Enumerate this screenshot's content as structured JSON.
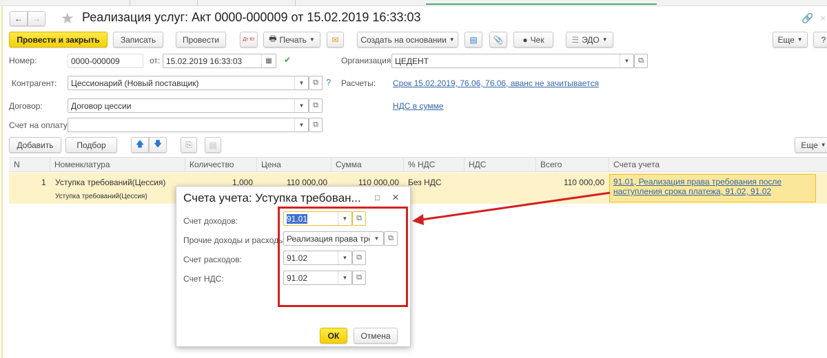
{
  "window": {
    "title": "Реализация услуг: Акт 0000-000009 от 15.02.2019 16:33:03"
  },
  "toolbar": {
    "post_close": "Провести и закрыть",
    "save": "Записать",
    "post": "Провести",
    "dtkt": "Дт Кт",
    "print": "Печать",
    "create_based": "Создать на основании",
    "check": "Чек",
    "edo": "ЭДО",
    "more": "Еще",
    "help": "?"
  },
  "form": {
    "number_label": "Номер:",
    "number": "0000-000009",
    "date_label": "от:",
    "date": "15.02.2019 16:33:03",
    "org_label": "Организация:",
    "org": "ЦЕДЕНТ",
    "counterparty_label": "Контрагент:",
    "counterparty": "Цессионарий (Новый поставщик)",
    "settlements_label": "Расчеты:",
    "settlements_link": "Срок 15.02.2019, 76.06, 76.06, аванс не зачитывается",
    "contract_label": "Договор:",
    "contract": "Договор цессии",
    "vat_link": "НДС в сумме",
    "invoice_label": "Счет на оплату:",
    "invoice": ""
  },
  "table_toolbar": {
    "add": "Добавить",
    "pick": "Подбор",
    "more": "Еще"
  },
  "table": {
    "columns": [
      "N",
      "Номенклатура",
      "Количество",
      "Цена",
      "Сумма",
      "% НДС",
      "НДС",
      "Всего",
      "Счета учета"
    ],
    "rows": [
      {
        "n": "1",
        "item": "Уступка требований(Цессия)",
        "item_sub": "Уступка требований(Цессия)",
        "qty": "1,000",
        "price": "110 000,00",
        "sum": "110 000,00",
        "vat_rate": "Без НДС",
        "vat": "",
        "total": "110 000,00",
        "accounts": "91.01, Реализация права требования после наступления срока платежа, 91.02, 91.02"
      }
    ]
  },
  "dialog": {
    "title": "Счета учета: Уступка требован...",
    "income_label": "Счет доходов:",
    "income": "91.01",
    "other_label": "Прочие доходы и расходы:",
    "other": "Реализация права треб",
    "expense_label": "Счет расходов:",
    "expense": "91.02",
    "vat_label": "Счет НДС:",
    "vat": "91.02",
    "ok": "ОК",
    "cancel": "Отмена"
  },
  "colors": {
    "accent_yellow": "#f5d000",
    "row_highlight": "#fdf2c8",
    "annotation_red": "#d42020",
    "link": "#3366aa"
  }
}
